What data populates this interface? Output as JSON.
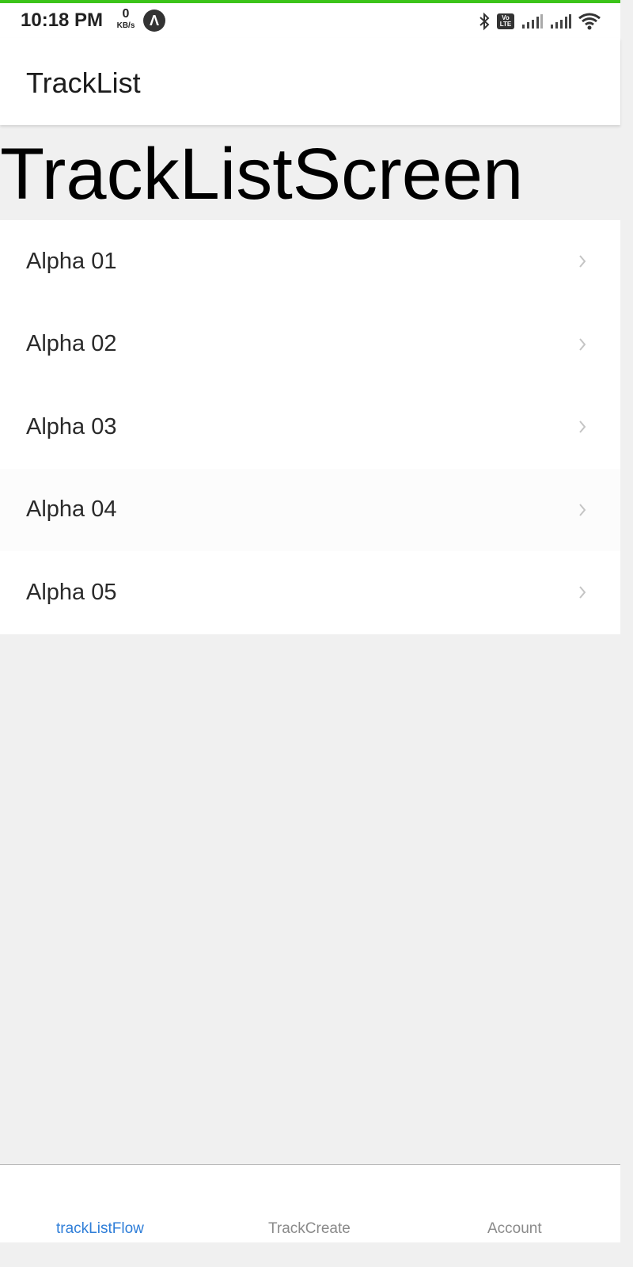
{
  "status_bar": {
    "time": "10:18 PM",
    "net_speed_value": "0",
    "net_speed_unit": "KB/s",
    "expo_badge": "Λ",
    "icons": [
      "bluetooth-icon",
      "volte-icon",
      "signal-icon",
      "signal-icon",
      "wifi-icon"
    ],
    "volte_top": "Vo",
    "volte_bottom": "LTE"
  },
  "header": {
    "title": "TrackList"
  },
  "screen": {
    "title": "TrackListScreen"
  },
  "list": {
    "items": [
      {
        "label": "Alpha 01"
      },
      {
        "label": "Alpha 02"
      },
      {
        "label": "Alpha 03"
      },
      {
        "label": "Alpha 04"
      },
      {
        "label": "Alpha 05"
      }
    ]
  },
  "tabs": [
    {
      "label": "trackListFlow",
      "active": true
    },
    {
      "label": "TrackCreate",
      "active": false
    },
    {
      "label": "Account",
      "active": false
    }
  ],
  "colors": {
    "accent": "#3cc41a",
    "active_tab": "#2f7ed8",
    "inactive_tab": "#8a8a8a",
    "background": "#f0f0f0"
  }
}
